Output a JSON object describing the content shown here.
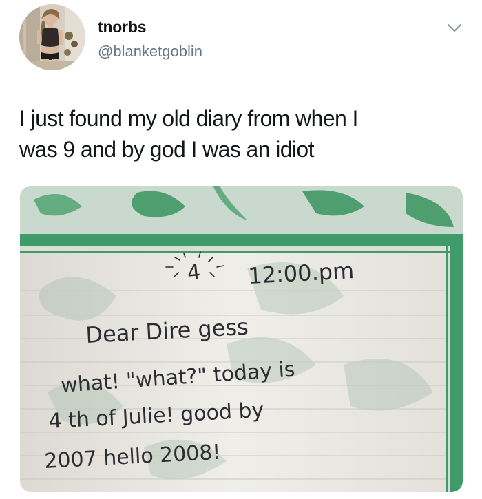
{
  "user": {
    "display_name": "tnorbs",
    "handle": "@blanketgoblin"
  },
  "tweet": {
    "lines": [
      "I just found my old diary from when I",
      "was 9 and by god I was an idiot"
    ]
  },
  "photo": {
    "diary_lines": [
      "4",
      "12:00.pm",
      "Dear Dire gess",
      "what! \"what?\" today is",
      "4 th of Julie! good by",
      "2007 hello 2008!"
    ]
  },
  "icons": {
    "menu": "chevron-down-icon"
  },
  "colors": {
    "text": "#14171a",
    "secondary": "#657786",
    "diary_green": "#3f9b6a",
    "diary_paper": "#ecebe6",
    "ink": "#2c2c33"
  }
}
